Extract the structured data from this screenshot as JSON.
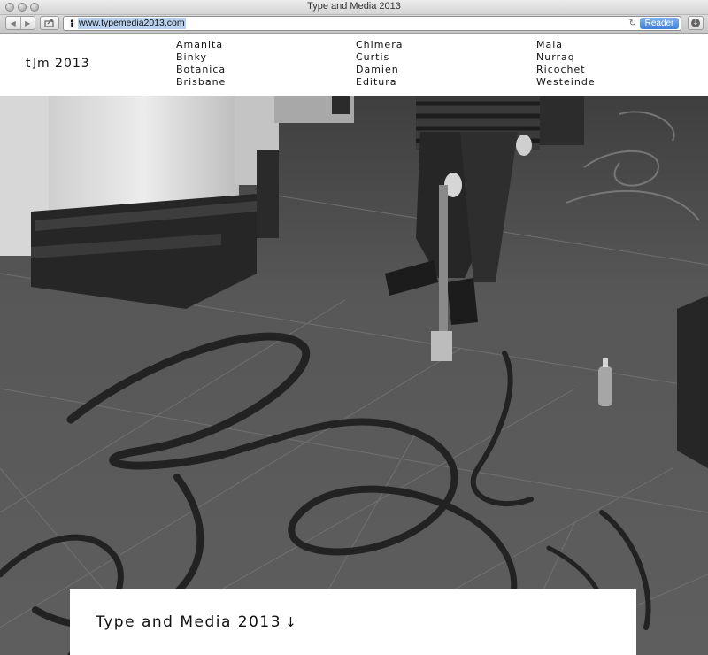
{
  "browser": {
    "window_title": "Type and Media 2013",
    "url": "www.typemedia2013.com",
    "reader_label": "Reader",
    "icons": {
      "back": "back-arrow-icon",
      "forward": "forward-arrow-icon",
      "share": "share-icon",
      "reload": "reload-icon",
      "downloads": "downloads-icon",
      "site": "site-identity-icon"
    },
    "accent_color": "#3f7fd6"
  },
  "site": {
    "logo": "t]m 2013",
    "nav_columns": [
      [
        "Amanita",
        "Binky",
        "Botanica",
        "Brisbane"
      ],
      [
        "Chimera",
        "Curtis",
        "Damien",
        "Editura"
      ],
      [
        "Mala",
        "Nurraq",
        "Ricochet",
        "Westeinde"
      ]
    ],
    "hero_title": "Type and Media 2013",
    "hero_arrow": "↓"
  }
}
